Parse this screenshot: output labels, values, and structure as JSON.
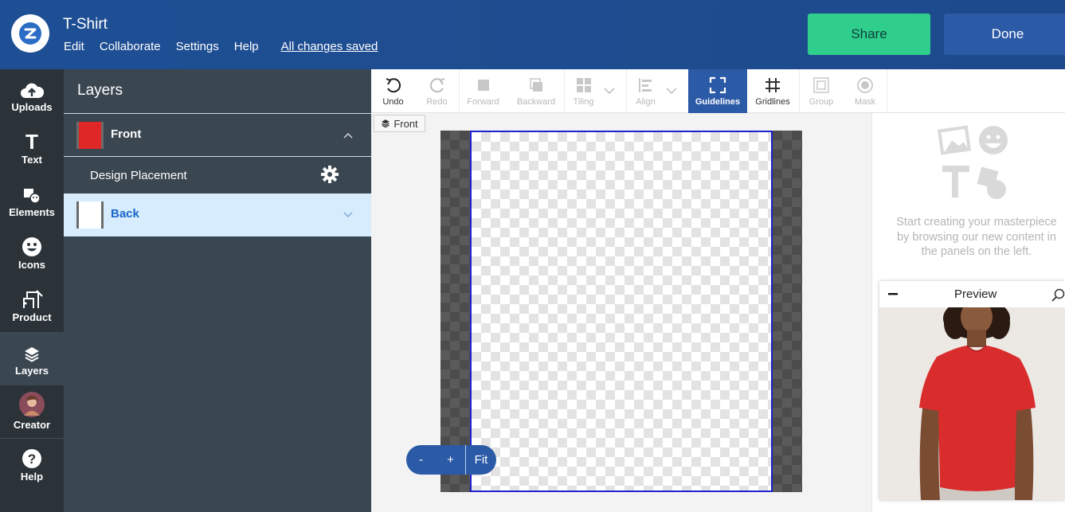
{
  "header": {
    "title": "T-Shirt",
    "menu": [
      "Edit",
      "Collaborate",
      "Settings",
      "Help"
    ],
    "saved_status": "All changes saved",
    "share_label": "Share",
    "done_label": "Done"
  },
  "leftnav": {
    "items": [
      {
        "label": "Uploads",
        "icon": "cloud-upload-icon"
      },
      {
        "label": "Text",
        "icon": "text-icon"
      },
      {
        "label": "Elements",
        "icon": "elements-icon"
      },
      {
        "label": "Icons",
        "icon": "smiley-icon"
      },
      {
        "label": "Product",
        "icon": "product-icon"
      },
      {
        "label": "Layers",
        "icon": "layers-icon"
      },
      {
        "label": "Creator",
        "icon": "avatar"
      },
      {
        "label": "Help",
        "icon": "help-icon"
      }
    ]
  },
  "layers": {
    "title": "Layers",
    "front": {
      "label": "Front",
      "color": "#e02727"
    },
    "placement": "Design Placement",
    "back": {
      "label": "Back",
      "color": "#ffffff"
    }
  },
  "toolbar": {
    "tools": [
      {
        "label": "Undo",
        "icon": "undo-icon",
        "state": "enabled"
      },
      {
        "label": "Redo",
        "icon": "redo-icon",
        "state": "disabled"
      },
      {
        "label": "Forward",
        "icon": "forward-icon",
        "state": "disabled"
      },
      {
        "label": "Backward",
        "icon": "backward-icon",
        "state": "disabled"
      },
      {
        "label": "Tiling",
        "icon": "tiling-icon",
        "state": "disabled"
      },
      {
        "label": "Align",
        "icon": "align-icon",
        "state": "disabled"
      },
      {
        "label": "Guidelines",
        "icon": "guidelines-icon",
        "state": "active"
      },
      {
        "label": "Gridlines",
        "icon": "gridlines-icon",
        "state": "enabled"
      },
      {
        "label": "Group",
        "icon": "group-icon",
        "state": "disabled"
      },
      {
        "label": "Mask",
        "icon": "mask-icon",
        "state": "disabled"
      }
    ]
  },
  "canvas": {
    "side_tag": "Front",
    "zoom_out": "-",
    "zoom_in": "+",
    "fit": "Fit"
  },
  "right": {
    "empty_message": "Start creating your masterpiece by browsing our new content in the panels on the left.",
    "preview_title": "Preview",
    "shirt_color": "#d92d2d"
  },
  "colors": {
    "header": "#1e4f94",
    "share": "#2fce8c",
    "done": "#2b5aa6",
    "nav": "#2c3338",
    "panel": "#3a4650",
    "selected_row": "#d7ecfc",
    "guide_border": "#2020d0"
  }
}
